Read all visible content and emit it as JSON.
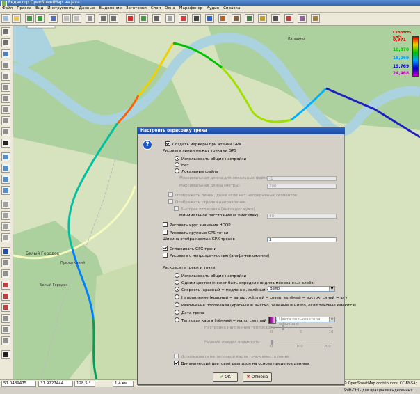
{
  "window": {
    "title": "Редактор OpenStreetMap на Java"
  },
  "menu": [
    "Файл",
    "Правка",
    "Вид",
    "Инструменты",
    "Данные",
    "Выделение",
    "Заготовки",
    "Слои",
    "Окна",
    "Марафонер",
    "Аудио",
    "Справка"
  ],
  "map": {
    "labels": {
      "town": "Белый Городок",
      "village1": "Прилогкиний",
      "village2": "Белый Городок",
      "place_top": "Капшино"
    },
    "legend": {
      "title": "Скорость, км/ч",
      "values": [
        "0,971",
        "10,370",
        "15,069",
        "19,769",
        "24,468"
      ],
      "colors": [
        "#e00000",
        "#00c000",
        "#00a0ff",
        "#0000c0",
        "#c000c0"
      ]
    }
  },
  "status": {
    "lat": "57.0489475",
    "lon": "37.9227444",
    "angle": "128,5 °",
    "dist": "1,4 км",
    "hint": "© OpenStreetMap contributors, CC-BY-SA; Shift-Ctrl - для вращения выделенных"
  },
  "dialog": {
    "title": "Настроить отрисовку трека",
    "create_markers": "Создать маркеры при чтении GPX",
    "draw_lines_heading": "Рисовать линии между точками GPS",
    "opt_general": "Использовать общие настройки",
    "opt_no": "Нет",
    "opt_local": "Локальные файлы",
    "max_len_local": "Максимальная длина для локальных файлов (метры)",
    "max_len_local_val": "-1",
    "max_len": "Максимальная длина (метры)",
    "max_len_val": "200",
    "draw_lines_hint": "Отображать линии, даже если нет непрерывных сегментов",
    "show_arrows": "Отображать стрелки направления",
    "fast_arrows": "Быстрая отрисовка (выглядит хуже)",
    "min_dist": "Минимальное расстояние (в пикселях)",
    "min_dist_val": "40",
    "hdop": "Рисовать круг значения HDOP",
    "big_points": "Рисовать крупные GPS точки",
    "width_label": "Ширина отображаемых GPX треков",
    "width_val": "3",
    "smooth": "Сглаживать GPX треки",
    "alpha": "Рисовать с непрозрачностью (альфа-наложение)",
    "color_heading": "Раскрасить треки и точки",
    "c_general": "Использовать общие настройки",
    "c_single": "Одним цветом (может быть определено для именованных слоёв)",
    "c_speed": "Скорость (красный = медленно, зелёный = быстро)",
    "c_speed_combo": "Вело",
    "c_dir": "Направление (красный = запад, жёлтый = север, зелёный = восток, синий = юг)",
    "c_dilution": "Различение положения (красный = высоко, зелёный = низко, если таковые имеются)",
    "c_time": "Дата трека",
    "c_heat": "Тепловая карта (тёмный = мало, светлый = много)",
    "heat_combo": "Цвета пользователя (обычная)",
    "heat_grid": "Настройка наложения теплокарты",
    "heat_grid_ticks": [
      "0",
      "5",
      "10"
    ],
    "heat_lower": "Нижний предел видимости",
    "heat_lower_ticks": [
      "0",
      "100",
      "200"
    ],
    "heat_points": "Использовать на тепловой карте точки вместо линий",
    "dynamic_range": "Динамический цветовой диапазон на основе пределов данных",
    "ok": "OK",
    "cancel": "Отмена"
  }
}
